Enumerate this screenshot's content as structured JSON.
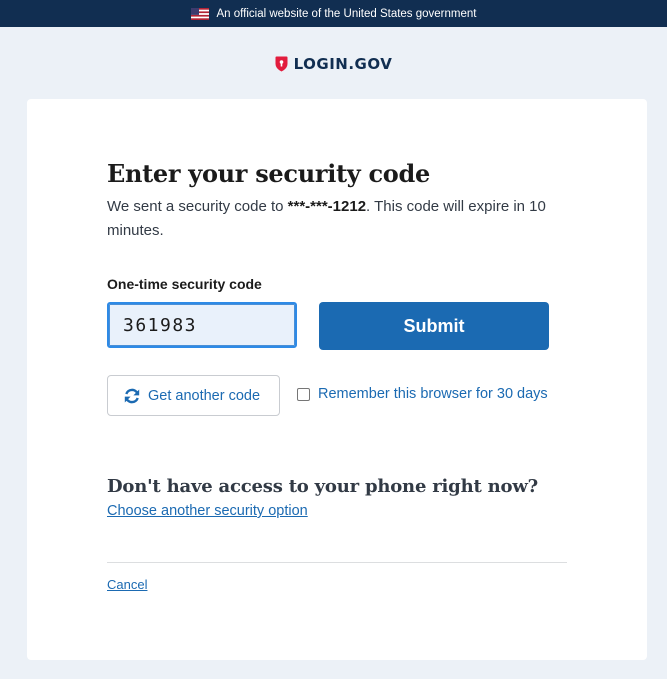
{
  "banner": {
    "text": "An official website of the United States government"
  },
  "brand": {
    "name": "LOGIN.GOV",
    "colors": {
      "navy": "#112e51",
      "red": "#e21c3d"
    }
  },
  "form": {
    "title": "Enter your security code",
    "description_before": "We sent a security code to ",
    "phone": "***-***-1212",
    "description_after": ". This code will expire in 10 minutes.",
    "code_label": "One-time security code",
    "code_value": "361983",
    "submit_label": "Submit",
    "resend_label": "Get another code",
    "remember_label": "Remember this browser for 30 days",
    "remember_checked": false
  },
  "alternatives": {
    "heading": "Don't have access to your phone right now?",
    "link_label": "Choose another security option"
  },
  "footer": {
    "cancel_label": "Cancel"
  },
  "colors": {
    "primary": "#1b6ab2",
    "background": "#ecf1f7",
    "banner": "#112e51"
  }
}
